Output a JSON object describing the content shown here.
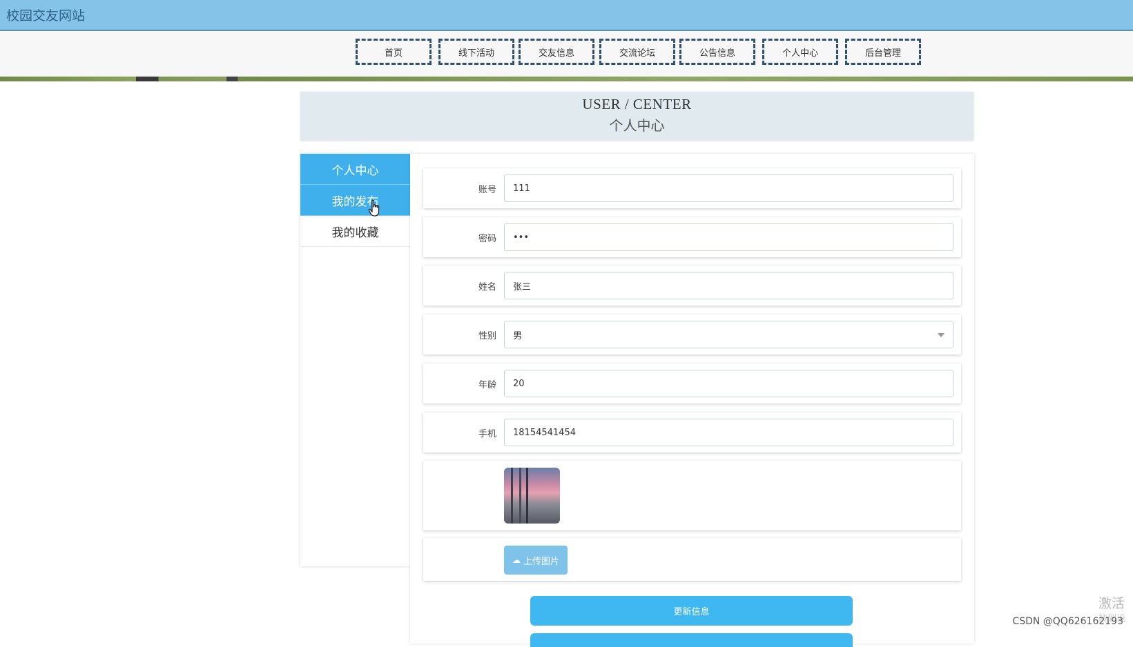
{
  "site": {
    "title": "校园交友网站"
  },
  "nav": {
    "items": [
      {
        "label": "首页"
      },
      {
        "label": "线下活动"
      },
      {
        "label": "交友信息"
      },
      {
        "label": "交流论坛"
      },
      {
        "label": "公告信息"
      },
      {
        "label": "个人中心"
      },
      {
        "label": "后台管理"
      }
    ]
  },
  "hero": {
    "title_en": "USER / CENTER",
    "title_cn": "个人中心"
  },
  "sidebar": {
    "items": [
      {
        "label": "个人中心"
      },
      {
        "label": "我的发布"
      },
      {
        "label": "我的收藏"
      }
    ]
  },
  "form": {
    "account": {
      "label": "账号",
      "value": "111"
    },
    "password": {
      "label": "密码",
      "value": "•••"
    },
    "name": {
      "label": "姓名",
      "value": "张三"
    },
    "gender": {
      "label": "性别",
      "value": "男"
    },
    "age": {
      "label": "年龄",
      "value": "20"
    },
    "phone": {
      "label": "手机",
      "value": "18154541454"
    },
    "upload_label": "上传图片",
    "submit_label": "更新信息"
  },
  "overlay": {
    "watermark": "CSDN @QQ626162193",
    "activate": "激活",
    "activate_sub": "转到设"
  },
  "colors": {
    "topbar": "#85c4e8",
    "accent": "#3fb0ec",
    "nav_border": "#2f5172"
  }
}
